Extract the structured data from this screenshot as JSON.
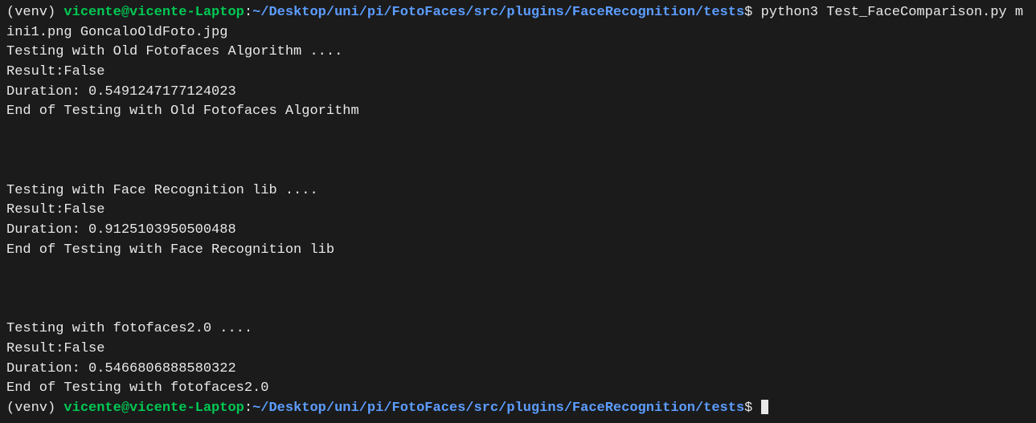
{
  "prompt1": {
    "venv": "(venv) ",
    "user_host": "vicente@vicente-Laptop",
    "colon": ":",
    "path": "~/Desktop/uni/pi/FotoFaces/src/plugins/FaceRecognition/tests",
    "dollar": "$ ",
    "command": "python3 Test_FaceComparison.py mini1.png GoncaloOldFoto.jpg"
  },
  "output": {
    "line1": "Testing with Old Fotofaces Algorithm ....",
    "line2": "Result:False",
    "line3": "Duration: 0.5491247177124023",
    "line4": "End of Testing with Old Fotofaces Algorithm",
    "line5": "Testing with Face Recognition lib ....",
    "line6": "Result:False",
    "line7": "Duration: 0.9125103950500488",
    "line8": "End of Testing with Face Recognition lib",
    "line9": "Testing with fotofaces2.0 ....",
    "line10": "Result:False",
    "line11": "Duration: 0.5466806888580322",
    "line12": "End of Testing with fotofaces2.0"
  },
  "prompt2": {
    "venv": "(venv) ",
    "user_host": "vicente@vicente-Laptop",
    "colon": ":",
    "path": "~/Desktop/uni/pi/FotoFaces/src/plugins/FaceRecognition/tests",
    "dollar": "$ "
  }
}
